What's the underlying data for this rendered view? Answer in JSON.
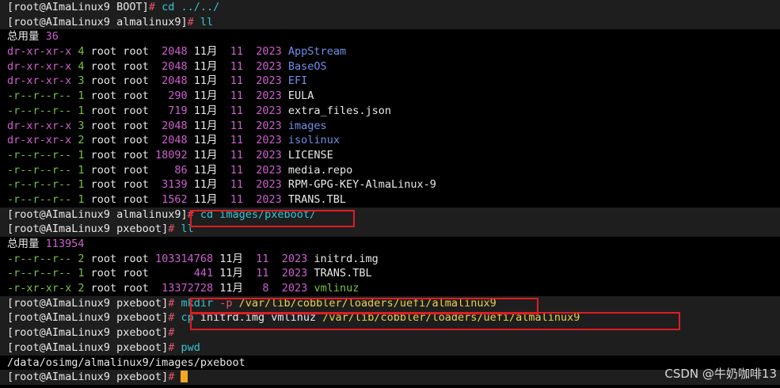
{
  "colors": {
    "background": "#000000",
    "default_text": "#e8e8e8",
    "prompt_punct": "#e2536b",
    "command": "#36c6d3",
    "directory": "#6f8fe8",
    "perm_dir": "#cf5fcf",
    "perm_file": "#79c240",
    "number": "#e8d24e",
    "highlight_box": "#e01c24",
    "cursor": "#f5a623"
  },
  "terminal": {
    "lines": [
      {
        "segs": [
          {
            "t": "[root@AImaLinux9 BOOT]",
            "c": "w"
          },
          {
            "t": "# ",
            "c": "r"
          },
          {
            "t": "cd ../../",
            "c": "c"
          }
        ]
      },
      {
        "segs": [
          {
            "t": "[root@AImaLinux9 almalinux9]",
            "c": "w"
          },
          {
            "t": "# ",
            "c": "r"
          },
          {
            "t": "ll",
            "c": "c"
          }
        ]
      },
      {
        "segs": [
          {
            "t": "总用量 ",
            "c": "w"
          },
          {
            "t": "36",
            "c": "m"
          }
        ]
      },
      {
        "segs": [
          {
            "t": "dr-xr-xr-x",
            "c": "m"
          },
          {
            "t": " 4 ",
            "c": "g"
          },
          {
            "t": "root root  ",
            "c": "w"
          },
          {
            "t": "2048",
            "c": "m"
          },
          {
            "t": " 11月  ",
            "c": "w"
          },
          {
            "t": "11",
            "c": "m"
          },
          {
            "t": "  ",
            "c": "w"
          },
          {
            "t": "2023",
            "c": "m"
          },
          {
            "t": " ",
            "c": "w"
          },
          {
            "t": "AppStream",
            "c": "b"
          }
        ]
      },
      {
        "segs": [
          {
            "t": "dr-xr-xr-x",
            "c": "m"
          },
          {
            "t": " 4 ",
            "c": "g"
          },
          {
            "t": "root root  ",
            "c": "w"
          },
          {
            "t": "2048",
            "c": "m"
          },
          {
            "t": " 11月  ",
            "c": "w"
          },
          {
            "t": "11",
            "c": "m"
          },
          {
            "t": "  ",
            "c": "w"
          },
          {
            "t": "2023",
            "c": "m"
          },
          {
            "t": " ",
            "c": "w"
          },
          {
            "t": "BaseOS",
            "c": "b"
          }
        ]
      },
      {
        "segs": [
          {
            "t": "dr-xr-xr-x",
            "c": "m"
          },
          {
            "t": " 3 ",
            "c": "g"
          },
          {
            "t": "root root  ",
            "c": "w"
          },
          {
            "t": "2048",
            "c": "m"
          },
          {
            "t": " 11月  ",
            "c": "w"
          },
          {
            "t": "11",
            "c": "m"
          },
          {
            "t": "  ",
            "c": "w"
          },
          {
            "t": "2023",
            "c": "m"
          },
          {
            "t": " ",
            "c": "w"
          },
          {
            "t": "EFI",
            "c": "b"
          }
        ]
      },
      {
        "segs": [
          {
            "t": "-r--r--r--",
            "c": "g"
          },
          {
            "t": " 1 ",
            "c": "g"
          },
          {
            "t": "root root   ",
            "c": "w"
          },
          {
            "t": "290",
            "c": "m"
          },
          {
            "t": " 11月  ",
            "c": "w"
          },
          {
            "t": "11",
            "c": "m"
          },
          {
            "t": "  ",
            "c": "w"
          },
          {
            "t": "2023",
            "c": "m"
          },
          {
            "t": " EULA",
            "c": "w"
          }
        ]
      },
      {
        "segs": [
          {
            "t": "-r--r--r--",
            "c": "g"
          },
          {
            "t": " 1 ",
            "c": "g"
          },
          {
            "t": "root root   ",
            "c": "w"
          },
          {
            "t": "719",
            "c": "m"
          },
          {
            "t": " 11月  ",
            "c": "w"
          },
          {
            "t": "11",
            "c": "m"
          },
          {
            "t": "  ",
            "c": "w"
          },
          {
            "t": "2023",
            "c": "m"
          },
          {
            "t": " extra_files.json",
            "c": "w"
          }
        ]
      },
      {
        "segs": [
          {
            "t": "dr-xr-xr-x",
            "c": "m"
          },
          {
            "t": " 3 ",
            "c": "g"
          },
          {
            "t": "root root  ",
            "c": "w"
          },
          {
            "t": "2048",
            "c": "m"
          },
          {
            "t": " 11月  ",
            "c": "w"
          },
          {
            "t": "11",
            "c": "m"
          },
          {
            "t": "  ",
            "c": "w"
          },
          {
            "t": "2023",
            "c": "m"
          },
          {
            "t": " ",
            "c": "w"
          },
          {
            "t": "images",
            "c": "b"
          }
        ]
      },
      {
        "segs": [
          {
            "t": "dr-xr-xr-x",
            "c": "m"
          },
          {
            "t": " 2 ",
            "c": "g"
          },
          {
            "t": "root root  ",
            "c": "w"
          },
          {
            "t": "2048",
            "c": "m"
          },
          {
            "t": " 11月  ",
            "c": "w"
          },
          {
            "t": "11",
            "c": "m"
          },
          {
            "t": "  ",
            "c": "w"
          },
          {
            "t": "2023",
            "c": "m"
          },
          {
            "t": " ",
            "c": "w"
          },
          {
            "t": "isolinux",
            "c": "b"
          }
        ]
      },
      {
        "segs": [
          {
            "t": "-r--r--r--",
            "c": "g"
          },
          {
            "t": " 1 ",
            "c": "g"
          },
          {
            "t": "root root ",
            "c": "w"
          },
          {
            "t": "18092",
            "c": "m"
          },
          {
            "t": " 11月  ",
            "c": "w"
          },
          {
            "t": "11",
            "c": "m"
          },
          {
            "t": "  ",
            "c": "w"
          },
          {
            "t": "2023",
            "c": "m"
          },
          {
            "t": " LICENSE",
            "c": "w"
          }
        ]
      },
      {
        "segs": [
          {
            "t": "-r--r--r--",
            "c": "g"
          },
          {
            "t": " 1 ",
            "c": "g"
          },
          {
            "t": "root root    ",
            "c": "w"
          },
          {
            "t": "86",
            "c": "m"
          },
          {
            "t": " 11月  ",
            "c": "w"
          },
          {
            "t": "11",
            "c": "m"
          },
          {
            "t": "  ",
            "c": "w"
          },
          {
            "t": "2023",
            "c": "m"
          },
          {
            "t": " media.repo",
            "c": "w"
          }
        ]
      },
      {
        "segs": [
          {
            "t": "-r--r--r--",
            "c": "g"
          },
          {
            "t": " 1 ",
            "c": "g"
          },
          {
            "t": "root root  ",
            "c": "w"
          },
          {
            "t": "3139",
            "c": "m"
          },
          {
            "t": " 11月  ",
            "c": "w"
          },
          {
            "t": "11",
            "c": "m"
          },
          {
            "t": "  ",
            "c": "w"
          },
          {
            "t": "2023",
            "c": "m"
          },
          {
            "t": " RPM-GPG-KEY-AlmaLinux-9",
            "c": "w"
          }
        ]
      },
      {
        "segs": [
          {
            "t": "-r--r--r--",
            "c": "g"
          },
          {
            "t": " 1 ",
            "c": "g"
          },
          {
            "t": "root root  ",
            "c": "w"
          },
          {
            "t": "1562",
            "c": "m"
          },
          {
            "t": " 11月  ",
            "c": "w"
          },
          {
            "t": "11",
            "c": "m"
          },
          {
            "t": "  ",
            "c": "w"
          },
          {
            "t": "2023",
            "c": "m"
          },
          {
            "t": " TRANS.TBL",
            "c": "w"
          }
        ]
      },
      {
        "segs": [
          {
            "t": "[root@AImaLinux9 almalinux9]",
            "c": "w"
          },
          {
            "t": "# ",
            "c": "r"
          },
          {
            "t": "cd images/pxeboot/",
            "c": "c"
          }
        ]
      },
      {
        "segs": [
          {
            "t": "[root@AImaLinux9 pxeboot]",
            "c": "w"
          },
          {
            "t": "# ",
            "c": "r"
          },
          {
            "t": "ll",
            "c": "c"
          }
        ]
      },
      {
        "segs": [
          {
            "t": "总用量 ",
            "c": "w"
          },
          {
            "t": "113954",
            "c": "m"
          }
        ]
      },
      {
        "segs": [
          {
            "t": "-r--r--r--",
            "c": "g"
          },
          {
            "t": " 2 ",
            "c": "g"
          },
          {
            "t": "root root ",
            "c": "w"
          },
          {
            "t": "103314768",
            "c": "m"
          },
          {
            "t": " 11月  ",
            "c": "w"
          },
          {
            "t": "11",
            "c": "m"
          },
          {
            "t": "  ",
            "c": "w"
          },
          {
            "t": "2023",
            "c": "m"
          },
          {
            "t": " initrd.img",
            "c": "w"
          }
        ]
      },
      {
        "segs": [
          {
            "t": "-r--r--r--",
            "c": "g"
          },
          {
            "t": " 1 ",
            "c": "g"
          },
          {
            "t": "root root       ",
            "c": "w"
          },
          {
            "t": "441",
            "c": "m"
          },
          {
            "t": " 11月  ",
            "c": "w"
          },
          {
            "t": "11",
            "c": "m"
          },
          {
            "t": "  ",
            "c": "w"
          },
          {
            "t": "2023",
            "c": "m"
          },
          {
            "t": " TRANS.TBL",
            "c": "w"
          }
        ]
      },
      {
        "segs": [
          {
            "t": "-r-xr-xr-x",
            "c": "g"
          },
          {
            "t": " 2 ",
            "c": "g"
          },
          {
            "t": "root root  ",
            "c": "w"
          },
          {
            "t": "13372728",
            "c": "m"
          },
          {
            "t": " 11月   ",
            "c": "w"
          },
          {
            "t": "8",
            "c": "m"
          },
          {
            "t": "  ",
            "c": "w"
          },
          {
            "t": "2023",
            "c": "m"
          },
          {
            "t": " ",
            "c": "w"
          },
          {
            "t": "vmlinuz",
            "c": "gs"
          }
        ]
      },
      {
        "segs": [
          {
            "t": "[root@AImaLinux9 pxeboot]",
            "c": "w"
          },
          {
            "t": "# ",
            "c": "r"
          },
          {
            "t": "mkdir",
            "c": "c"
          },
          {
            "t": " -p ",
            "c": "r"
          },
          {
            "t": "/var/lib/cobbler/loaders/uefi/almalinux9",
            "c": "y"
          }
        ]
      },
      {
        "segs": [
          {
            "t": "[root@AImaLinux9 pxeboot]",
            "c": "w"
          },
          {
            "t": "# ",
            "c": "r"
          },
          {
            "t": "cp",
            "c": "c"
          },
          {
            "t": " initrd.img vmlinuz ",
            "c": "w"
          },
          {
            "t": "/var/lib/cobbler/loaders/uefi/almalinux9",
            "c": "y"
          }
        ]
      },
      {
        "segs": [
          {
            "t": "[root@AImaLinux9 pxeboot]",
            "c": "w"
          },
          {
            "t": "#",
            "c": "r"
          }
        ]
      },
      {
        "segs": [
          {
            "t": "[root@AImaLinux9 pxeboot]",
            "c": "w"
          },
          {
            "t": "# ",
            "c": "r"
          },
          {
            "t": "pwd",
            "c": "c"
          }
        ]
      },
      {
        "segs": [
          {
            "t": "/data/osimg/almalinux9/images/pxeboot",
            "c": "w"
          }
        ]
      },
      {
        "segs": [
          {
            "t": "[root@AImaLinux9 pxeboot]",
            "c": "w"
          },
          {
            "t": "# ",
            "c": "r"
          }
        ],
        "cursor": true
      }
    ],
    "highlighted_lines": [
      0,
      1,
      14,
      15,
      20,
      21,
      22,
      23,
      25
    ],
    "boxed_commands": [
      14,
      20,
      21
    ]
  },
  "watermark": "CSDN @牛奶咖啡13"
}
